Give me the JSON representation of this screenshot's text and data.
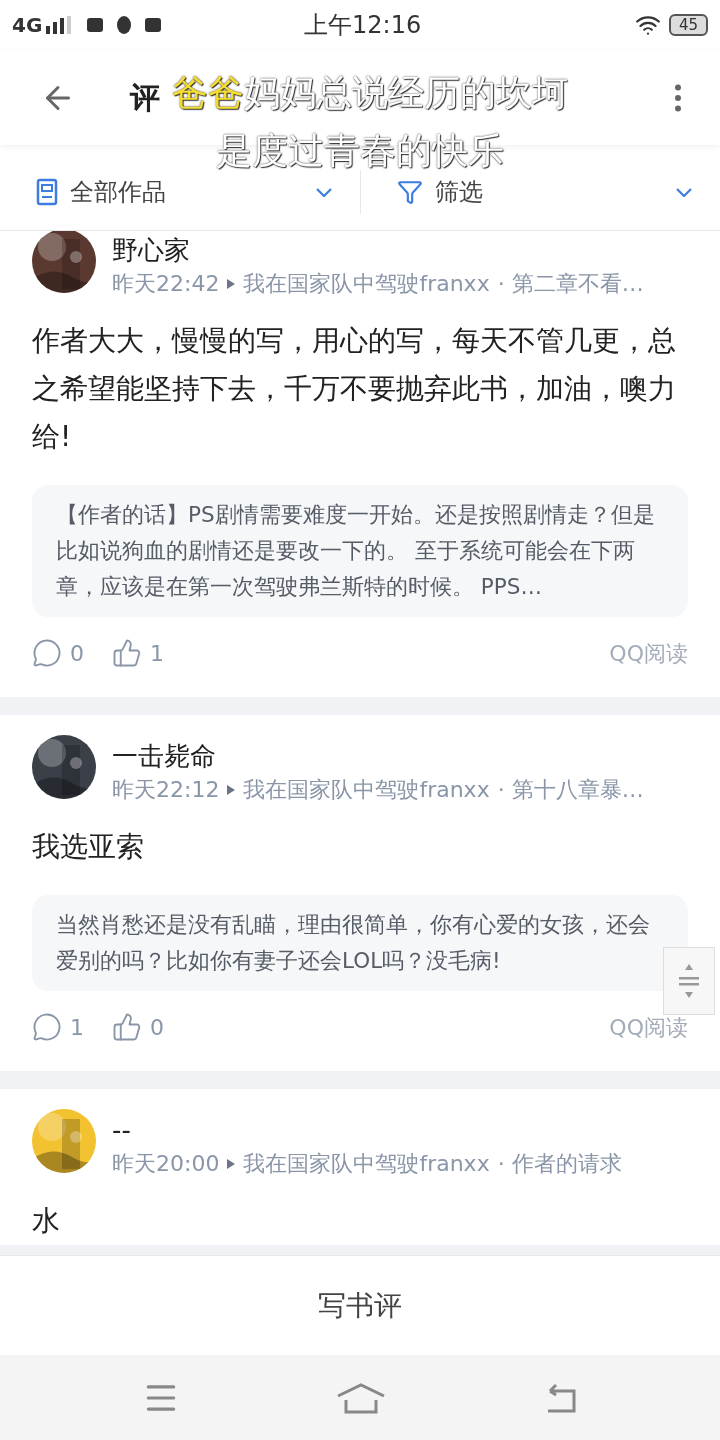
{
  "status_bar": {
    "network": "4G",
    "time": "上午12:16",
    "battery": "45"
  },
  "header": {
    "title": "评"
  },
  "lyrics_overlay": {
    "lines": [
      [
        {
          "text": "爸爸",
          "highlighted": true
        },
        {
          "text": "妈妈总说经历的坎坷",
          "highlighted": false
        }
      ],
      [
        {
          "text": "是度过青春的快乐",
          "highlighted": false
        }
      ]
    ]
  },
  "filters": [
    {
      "label": "全部作品",
      "kind": "works"
    },
    {
      "label": "筛选",
      "kind": "filter"
    }
  ],
  "comments": [
    {
      "user": "野心家",
      "time": "昨天22:42",
      "book": "我在国家队中驾驶franxx",
      "chapter": "· 第二章不看…",
      "body": "作者大大，慢慢的写，用心的写，每天不管几更，总之希望能坚持下去，千万不要抛弃此书，加油，噢力给!",
      "quote": "【作者的话】PS剧情需要难度一开始。还是按照剧情走？但是比如说狗血的剧情还是要改一下的。 至于系统可能会在下两章，应该是在第一次驾驶弗兰斯特的时候。 PPS…",
      "replies": "0",
      "likes": "1",
      "source": "QQ阅读"
    },
    {
      "user": "一击毙命",
      "time": "昨天22:12",
      "book": "我在国家队中驾驶franxx",
      "chapter": "· 第十八章暴…",
      "body": "我选亚索",
      "quote": "当然肖愁还是没有乱瞄，理由很简单，你有心爱的女孩，还会爱别的吗？比如你有妻子还会LOL吗？没毛病!",
      "replies": "1",
      "likes": "0",
      "source": "QQ阅读"
    },
    {
      "user": "--",
      "time": "昨天20:00",
      "book": "我在国家队中驾驶franxx",
      "chapter": "· 作者的请求",
      "body": "水"
    }
  ],
  "write_button": "写书评"
}
